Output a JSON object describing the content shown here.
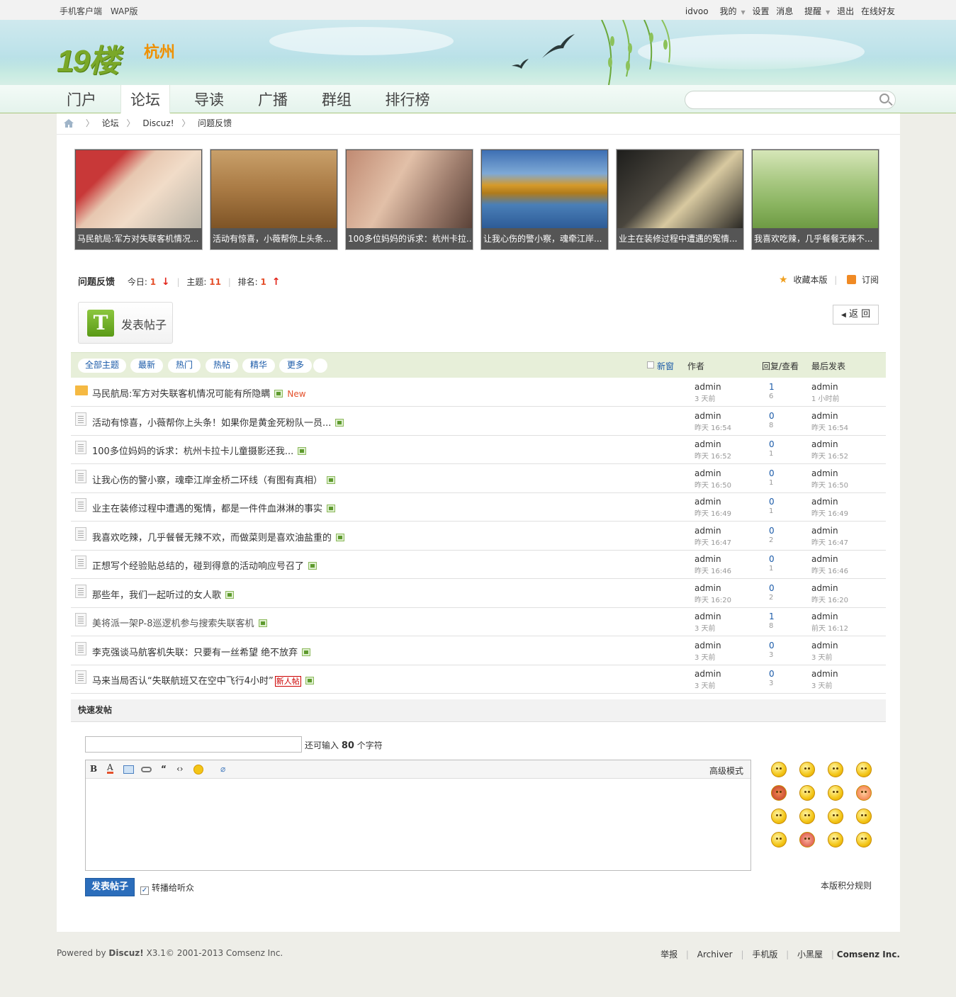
{
  "topbar": {
    "left": [
      "手机客户端",
      "WAP版"
    ],
    "user": "idvoo",
    "items": [
      "我的",
      "设置",
      "消息",
      "提醒",
      "退出",
      "在线好友"
    ]
  },
  "brand": {
    "logo": "19楼",
    "city": "杭州"
  },
  "nav": [
    "门户",
    "论坛",
    "导读",
    "广播",
    "群组",
    "排行榜"
  ],
  "nav_active": "论坛",
  "search": {
    "placeholder": ""
  },
  "breadcrumb": [
    "论坛",
    "Discuz!",
    "问题反馈"
  ],
  "slides": [
    {
      "caption": "马民航局:军方对失联客机情况...",
      "color": "#b8b8b0"
    },
    {
      "caption": "活动有惊喜，小薇帮你上头条...",
      "color": "#a97a44"
    },
    {
      "caption": "100多位妈妈的诉求：杭州卡拉...",
      "color": "#a58878"
    },
    {
      "caption": "让我心伤的警小察，魂牵江岸...",
      "color": "#4f7fb6"
    },
    {
      "caption": "业主在装修过程中遭遇的冤情...",
      "color": "#3c3a35"
    },
    {
      "caption": "我喜欢吃辣，几乎餐餐无辣不...",
      "color": "#8ab460"
    }
  ],
  "forum": {
    "name": "问题反馈",
    "today_label": "今日:",
    "today": "1",
    "threads_label": "主题:",
    "threads": "11",
    "rank_label": "排名:",
    "rank": "1",
    "fav": "收藏本版",
    "rss": "订阅",
    "post_button": "发表帖子",
    "back": "返 回"
  },
  "filters": [
    "全部主题",
    "最新",
    "热门",
    "热帖",
    "精华",
    "更多"
  ],
  "columns": {
    "newwin": "新窗",
    "author": "作者",
    "replies": "回复/查看",
    "last": "最后发表"
  },
  "threads": [
    {
      "title": "马民航局:军方对失联客机情况可能有所隐瞒",
      "author": "admin",
      "date": "3 天前",
      "replies": "1",
      "views": "6",
      "last_user": "admin",
      "last_time": "1 小时前",
      "new": "New",
      "folder": true
    },
    {
      "title": "活动有惊喜，小薇帮你上头条！如果你是黄金死粉队一员...",
      "author": "admin",
      "date": "昨天 16:54",
      "replies": "0",
      "views": "8",
      "last_user": "admin",
      "last_time": "昨天 16:54"
    },
    {
      "title": "100多位妈妈的诉求：杭州卡拉卡儿童摄影还我...",
      "author": "admin",
      "date": "昨天 16:52",
      "replies": "0",
      "views": "1",
      "last_user": "admin",
      "last_time": "昨天 16:52"
    },
    {
      "title": "让我心伤的警小察，魂牵江岸金桥二环线（有图有真相）",
      "author": "admin",
      "date": "昨天 16:50",
      "replies": "0",
      "views": "1",
      "last_user": "admin",
      "last_time": "昨天 16:50"
    },
    {
      "title": "业主在装修过程中遭遇的冤情，都是一件件血淋淋的事实",
      "author": "admin",
      "date": "昨天 16:49",
      "replies": "0",
      "views": "1",
      "last_user": "admin",
      "last_time": "昨天 16:49"
    },
    {
      "title": "我喜欢吃辣，几乎餐餐无辣不欢，而做菜则是喜欢油盐重的",
      "author": "admin",
      "date": "昨天 16:47",
      "replies": "0",
      "views": "2",
      "last_user": "admin",
      "last_time": "昨天 16:47"
    },
    {
      "title": "正想写个经验贴总结的，碰到得意的活动响应号召了",
      "author": "admin",
      "date": "昨天 16:46",
      "replies": "0",
      "views": "1",
      "last_user": "admin",
      "last_time": "昨天 16:46"
    },
    {
      "title": "那些年，我们一起听过的女人歌",
      "author": "admin",
      "date": "昨天 16:20",
      "replies": "0",
      "views": "2",
      "last_user": "admin",
      "last_time": "昨天 16:20"
    },
    {
      "title": "美将派一架P-8巡逻机参与搜索失联客机",
      "author": "admin",
      "date": "3 天前",
      "replies": "1",
      "views": "8",
      "last_user": "admin",
      "last_time": "前天 16:12",
      "grey": true
    },
    {
      "title": "李克强谈马航客机失联：只要有一丝希望 绝不放弃",
      "author": "admin",
      "date": "3 天前",
      "replies": "0",
      "views": "3",
      "last_user": "admin",
      "last_time": "3 天前"
    },
    {
      "title": "马来当局否认“失联航班又在空中飞行4小时”",
      "author": "admin",
      "date": "3 天前",
      "replies": "0",
      "views": "3",
      "last_user": "admin",
      "last_time": "3 天前",
      "newpost": "新人帖"
    }
  ],
  "quick": {
    "title": "快速发帖",
    "hint_prefix": "还可输入",
    "hint_count": "80",
    "hint_suffix": "个字符",
    "advanced": "高级模式",
    "submit": "发表帖子",
    "forward": "转播给听众",
    "rules": "本版积分规则"
  },
  "footer": {
    "powered": "Powered by",
    "product": "Discuz!",
    "version": "X3.1",
    "copy": "© 2001-2013 Comsenz Inc.",
    "links": [
      "举报",
      "Archiver",
      "手机版",
      "小黑屋"
    ],
    "company": "Comsenz Inc."
  }
}
